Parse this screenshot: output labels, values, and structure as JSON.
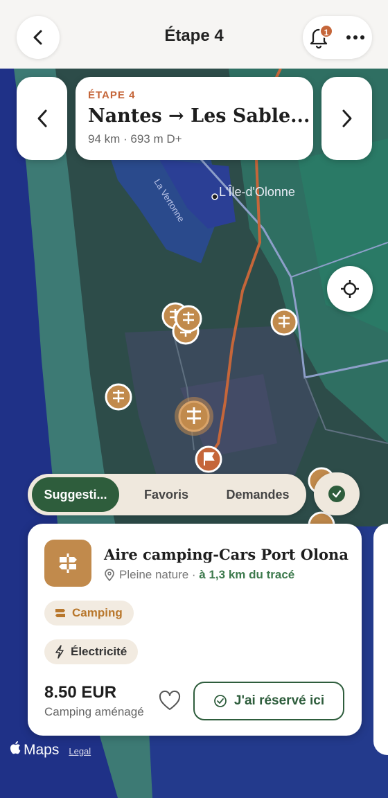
{
  "header": {
    "title": "Étape 4",
    "notifications_count": "1"
  },
  "stage": {
    "label": "ÉTAPE 4",
    "route": "Nantes → Les Sable...",
    "meta": "94 km · 693 m D+"
  },
  "map": {
    "place_label": "L'Île-d'Olonne",
    "river_label": "La Vertonne",
    "route_color": "#c5663a",
    "marker_color": "#c18a4c"
  },
  "tabs": [
    {
      "label": "Suggesti...",
      "active": true
    },
    {
      "label": "Favoris",
      "active": false
    },
    {
      "label": "Demandes",
      "active": false
    }
  ],
  "place": {
    "title": "Aire camping-Cars Port Olona",
    "location": "Pleine nature",
    "distance": "à 1,3 km du tracé",
    "tags": [
      "Camping",
      "Électricité"
    ],
    "price": "8.50 EUR",
    "price_sub": "Camping aménagé",
    "reserve_label": "J'ai réservé ici"
  },
  "attribution": {
    "maps": "Maps",
    "legal": "Legal"
  },
  "colors": {
    "accent_green": "#2e5d3c",
    "accent_orange": "#c5663a"
  }
}
